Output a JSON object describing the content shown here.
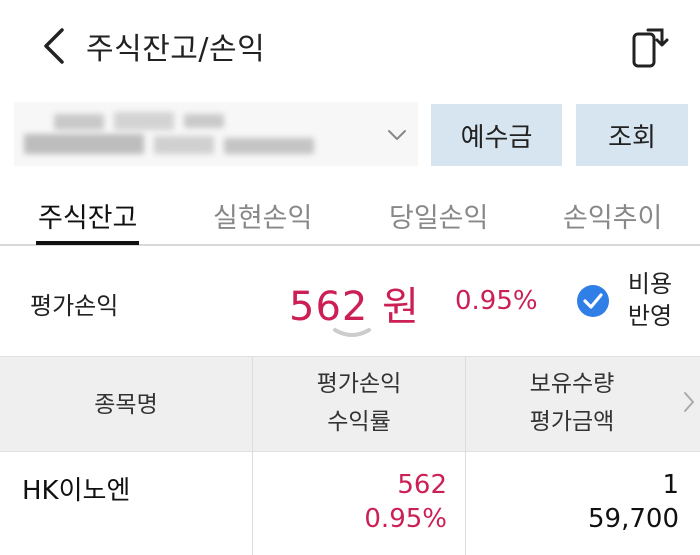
{
  "header": {
    "title": "주식잔고/손익",
    "back_icon": "chevron-left-icon",
    "share_icon": "share-export-icon"
  },
  "account": {
    "masked": true,
    "dropdown_icon": "chevron-down-icon"
  },
  "buttons": {
    "deposit_label": "예수금",
    "query_label": "조회"
  },
  "tabs": [
    {
      "label": "주식잔고",
      "active": true
    },
    {
      "label": "실현손익",
      "active": false
    },
    {
      "label": "당일손익",
      "active": false
    },
    {
      "label": "손익추이",
      "active": false
    }
  ],
  "summary": {
    "label": "평가손익",
    "amount": "562 원",
    "rate": "0.95%",
    "cost_checked": true,
    "cost_label_line1": "비용",
    "cost_label_line2": "반영"
  },
  "table": {
    "headers": {
      "name": "종목명",
      "pnl_line1": "평가손익",
      "pnl_line2": "수익률",
      "hold_line1": "보유수량",
      "hold_line2": "평가금액"
    },
    "rows": [
      {
        "name": "HK이노엔",
        "pnl": "562",
        "rate": "0.95%",
        "qty": "1",
        "value": "59,700"
      }
    ]
  },
  "colors": {
    "profit": "#cc1f55",
    "button_bg": "#d6e5ef",
    "check": "#2f7fe6"
  }
}
